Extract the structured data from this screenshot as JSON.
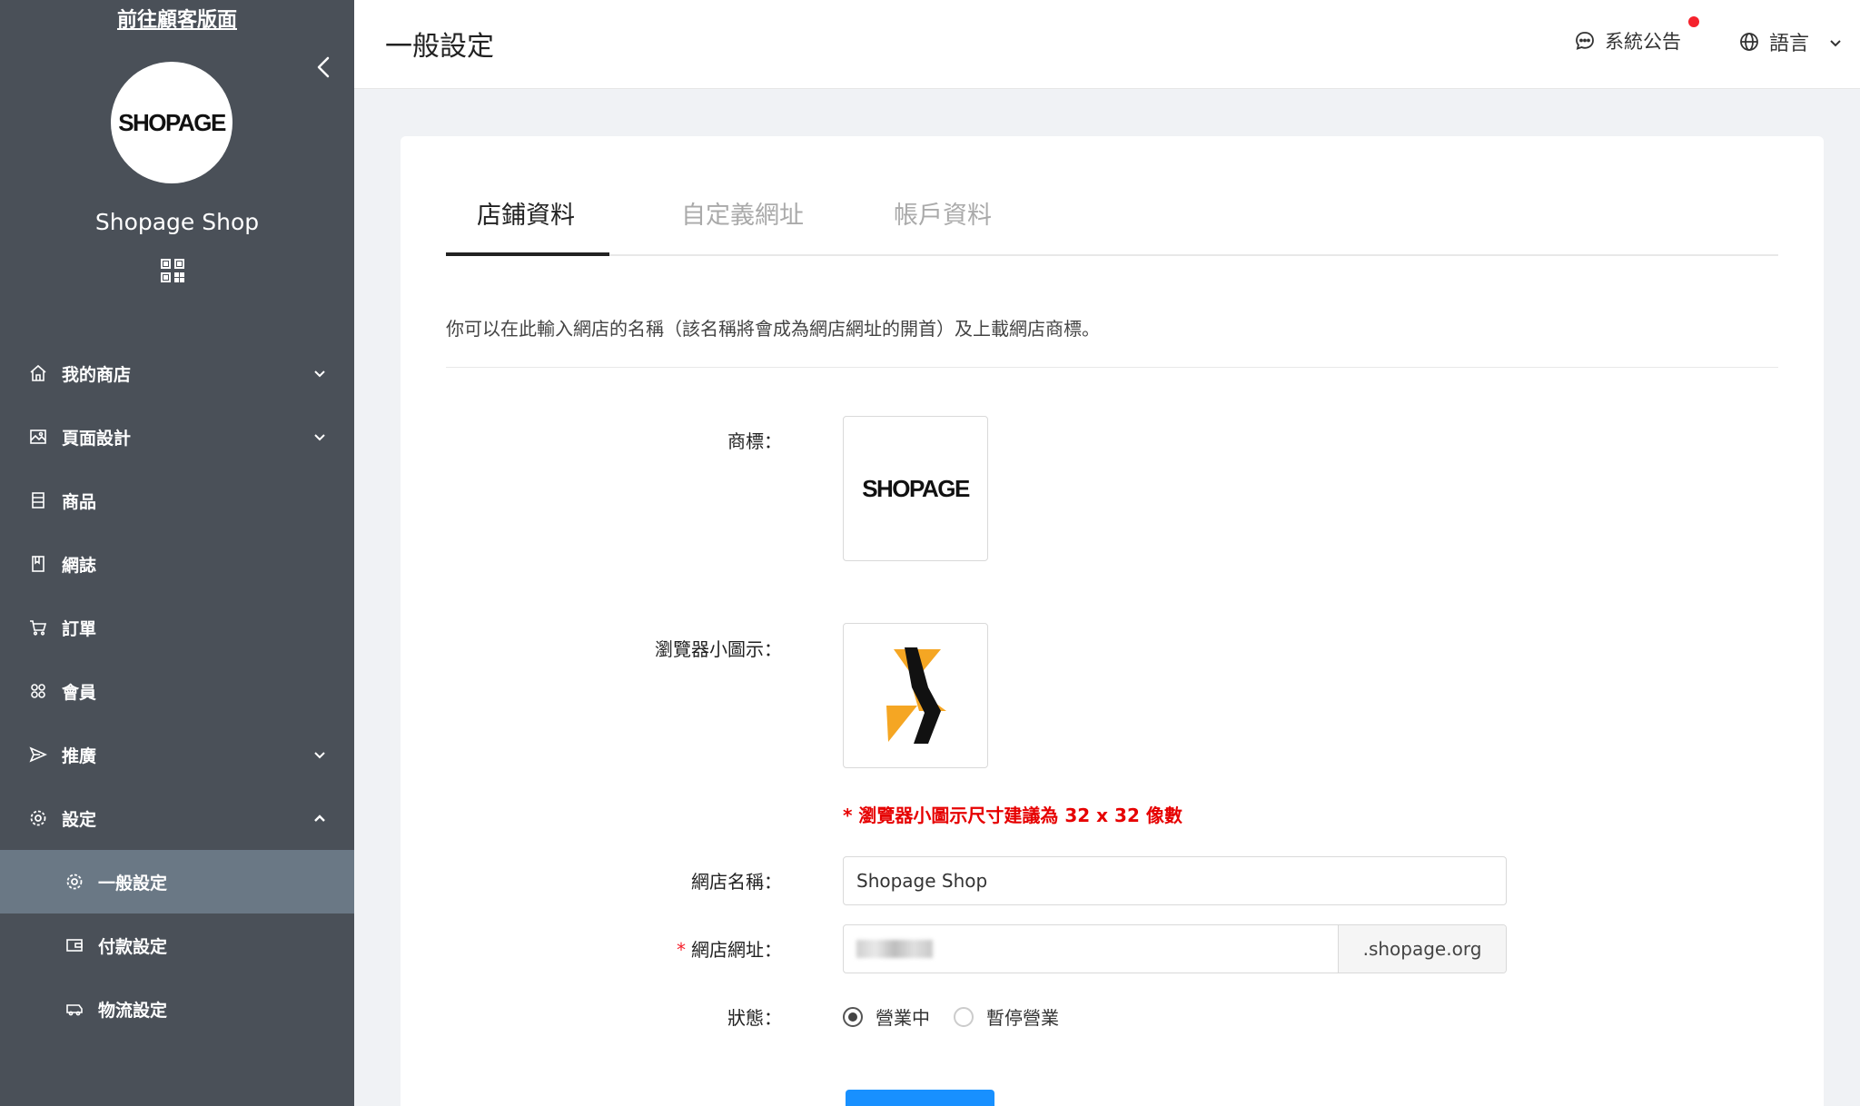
{
  "sidebar": {
    "visit_link": "前往顧客版面",
    "logo_text": "SHOPAGE",
    "shop_name": "Shopage Shop",
    "nav": [
      {
        "label": "我的商店",
        "icon": "home-icon",
        "chevron": "down"
      },
      {
        "label": "頁面設計",
        "icon": "image-icon",
        "chevron": "down"
      },
      {
        "label": "商品",
        "icon": "list-icon"
      },
      {
        "label": "網誌",
        "icon": "book-icon"
      },
      {
        "label": "訂單",
        "icon": "cart-icon"
      },
      {
        "label": "會員",
        "icon": "users-icon"
      },
      {
        "label": "推廣",
        "icon": "promo-icon",
        "chevron": "down"
      },
      {
        "label": "設定",
        "icon": "gear-icon",
        "chevron": "up"
      }
    ],
    "sub_nav": [
      {
        "label": "一般設定",
        "icon": "gear-icon",
        "active": true
      },
      {
        "label": "付款設定",
        "icon": "wallet-icon"
      },
      {
        "label": "物流設定",
        "icon": "truck-icon"
      }
    ]
  },
  "topbar": {
    "title": "一般設定",
    "announcement": "系統公告",
    "language": "語言"
  },
  "tabs": [
    "店鋪資料",
    "自定義網址",
    "帳戶資料"
  ],
  "form": {
    "description": "你可以在此輸入網店的名稱（該名稱將會成為網店網址的開首）及上載網店商標。",
    "logo_label": "商標：",
    "logo_text": "SHOPAGE",
    "favicon_label": "瀏覽器小圖示：",
    "favicon_hint": "* 瀏覽器小圖示尺寸建議為 32 x 32 像數",
    "name_label": "網店名稱：",
    "name_value": "Shopage Shop",
    "url_required": "*",
    "url_label": "網店網址：",
    "url_suffix": ".shopage.org",
    "status_label": "狀態：",
    "status_open": "營業中",
    "status_paused": "暫停營業"
  },
  "colors": {
    "sidebar_bg": "#4a5058",
    "sidebar_active": "#6a7885",
    "accent": "#1890ff",
    "notification": "#f5222d",
    "hint": "#e60000"
  }
}
